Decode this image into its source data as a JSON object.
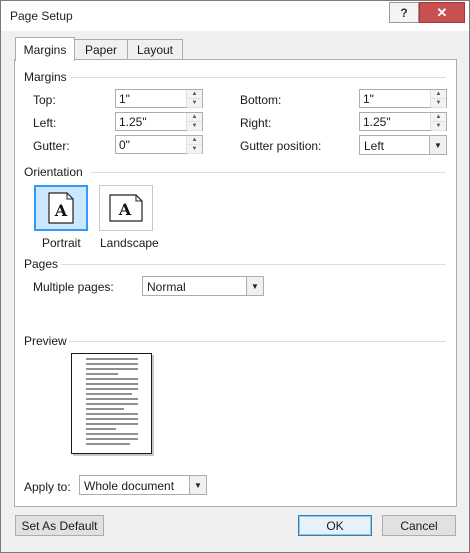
{
  "window": {
    "title": "Page Setup",
    "help_label": "?",
    "close_label": "✕"
  },
  "tabs": [
    {
      "label": "Margins",
      "active": true
    },
    {
      "label": "Paper",
      "active": false
    },
    {
      "label": "Layout",
      "active": false
    }
  ],
  "margins": {
    "section_label": "Margins",
    "top": {
      "label": "Top:",
      "value": "1\""
    },
    "bottom": {
      "label": "Bottom:",
      "value": "1\""
    },
    "left": {
      "label": "Left:",
      "value": "1.25\""
    },
    "right": {
      "label": "Right:",
      "value": "1.25\""
    },
    "gutter": {
      "label": "Gutter:",
      "value": "0\""
    },
    "gutter_position": {
      "label": "Gutter position:",
      "value": "Left"
    }
  },
  "orientation": {
    "section_label": "Orientation",
    "portrait": {
      "label": "Portrait",
      "glyph": "A",
      "selected": true
    },
    "landscape": {
      "label": "Landscape",
      "glyph": "A",
      "selected": false
    }
  },
  "pages": {
    "section_label": "Pages",
    "multiple_pages": {
      "label": "Multiple pages:",
      "value": "Normal"
    }
  },
  "preview": {
    "section_label": "Preview"
  },
  "apply_to": {
    "label": "Apply to:",
    "value": "Whole document"
  },
  "buttons": {
    "set_as_default": "Set As Default",
    "ok": "OK",
    "cancel": "Cancel"
  },
  "colors": {
    "selection_border": "#3399ff",
    "selection_fill": "#cce8ff",
    "close_button": "#c75050"
  }
}
